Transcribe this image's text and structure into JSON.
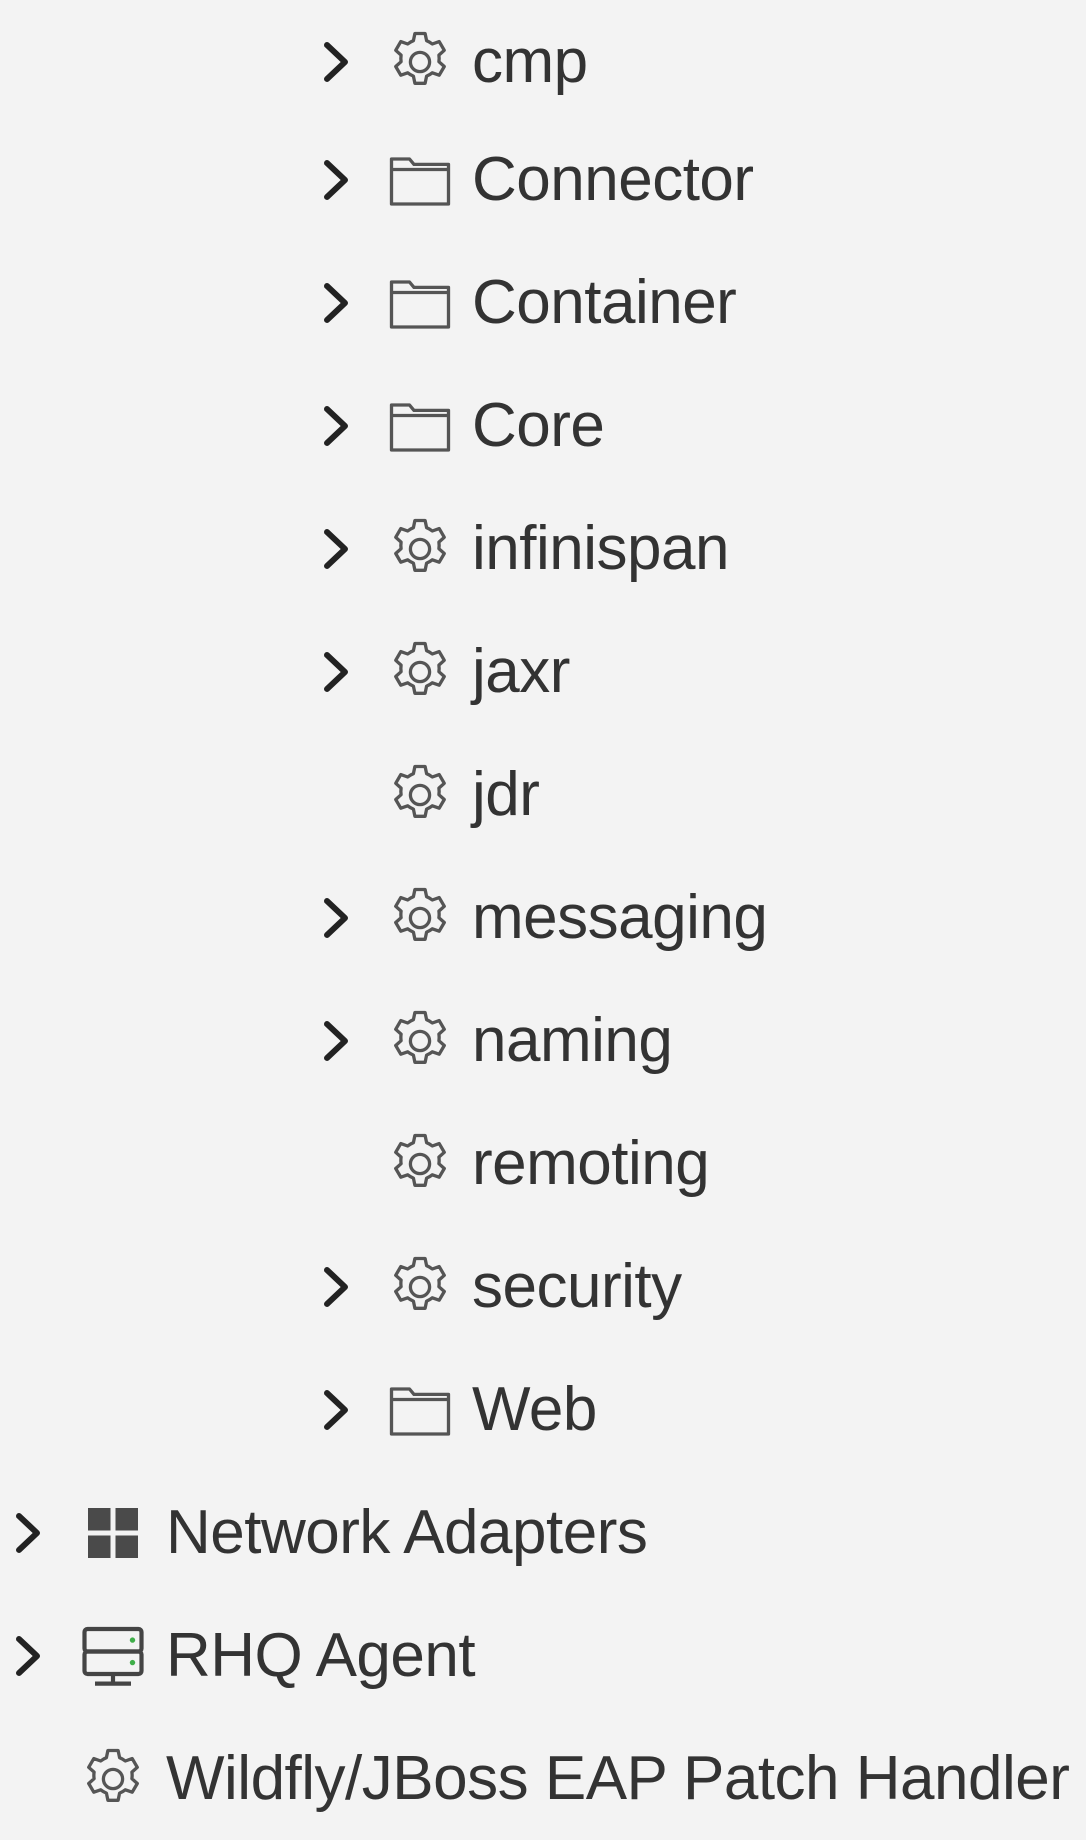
{
  "tree": {
    "children": [
      {
        "label": "cmp",
        "icon": "gear-icon",
        "expandable": true
      },
      {
        "label": "Connector",
        "icon": "folder-icon",
        "expandable": true
      },
      {
        "label": "Container",
        "icon": "folder-icon",
        "expandable": true
      },
      {
        "label": "Core",
        "icon": "folder-icon",
        "expandable": true
      },
      {
        "label": "infinispan",
        "icon": "gear-icon",
        "expandable": true
      },
      {
        "label": "jaxr",
        "icon": "gear-icon",
        "expandable": true
      },
      {
        "label": "jdr",
        "icon": "gear-icon",
        "expandable": false
      },
      {
        "label": "messaging",
        "icon": "gear-icon",
        "expandable": true
      },
      {
        "label": "naming",
        "icon": "gear-icon",
        "expandable": true
      },
      {
        "label": "remoting",
        "icon": "gear-icon",
        "expandable": false
      },
      {
        "label": "security",
        "icon": "gear-icon",
        "expandable": true
      },
      {
        "label": "Web",
        "icon": "folder-icon",
        "expandable": true
      }
    ],
    "roots": [
      {
        "label": "Network Adapters",
        "icon": "grid-icon",
        "expandable": true
      },
      {
        "label": "RHQ Agent",
        "icon": "server-icon",
        "expandable": true
      },
      {
        "label": "Wildfly/JBoss EAP Patch Handler",
        "icon": "gear-icon",
        "expandable": false
      }
    ]
  },
  "colors": {
    "background": "#f3f3f3",
    "text": "#333333",
    "icon": "#555555",
    "chevron": "#222222"
  }
}
